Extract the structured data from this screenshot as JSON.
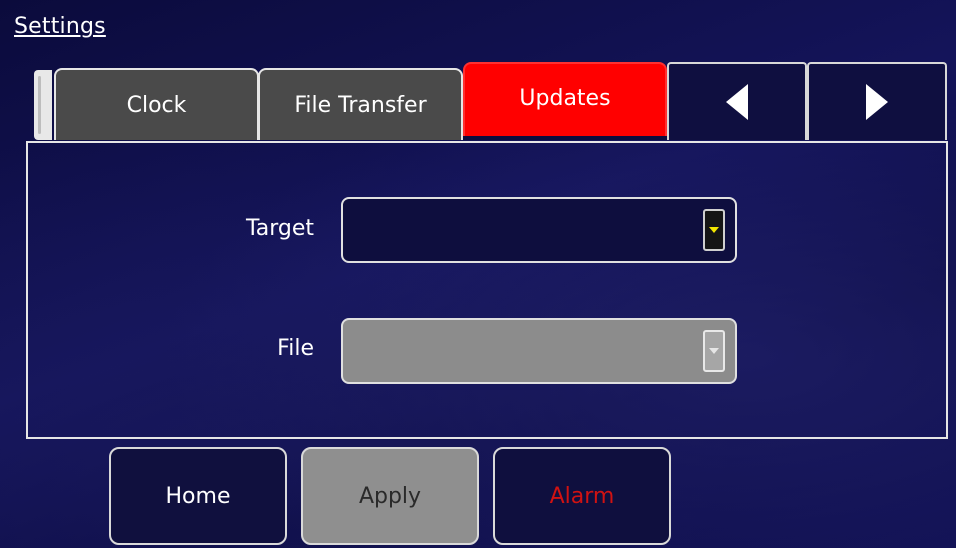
{
  "header": {
    "title": "Settings"
  },
  "tabs": [
    {
      "label": "Clock",
      "active": false
    },
    {
      "label": "File Transfer",
      "active": false
    },
    {
      "label": "Updates",
      "active": true
    }
  ],
  "tab_nav": {
    "prev_icon": "triangle-left-icon",
    "next_icon": "triangle-right-icon"
  },
  "form": {
    "target": {
      "label": "Target",
      "value": "",
      "enabled": true
    },
    "file": {
      "label": "File",
      "value": "",
      "enabled": false
    }
  },
  "buttons": {
    "home": "Home",
    "apply": "Apply",
    "alarm": "Alarm"
  },
  "colors": {
    "active_tab": "#ff0000",
    "alarm_text": "#d01212",
    "target_dropdown_arrow": "#f2e600",
    "background": "#0d0d44"
  }
}
